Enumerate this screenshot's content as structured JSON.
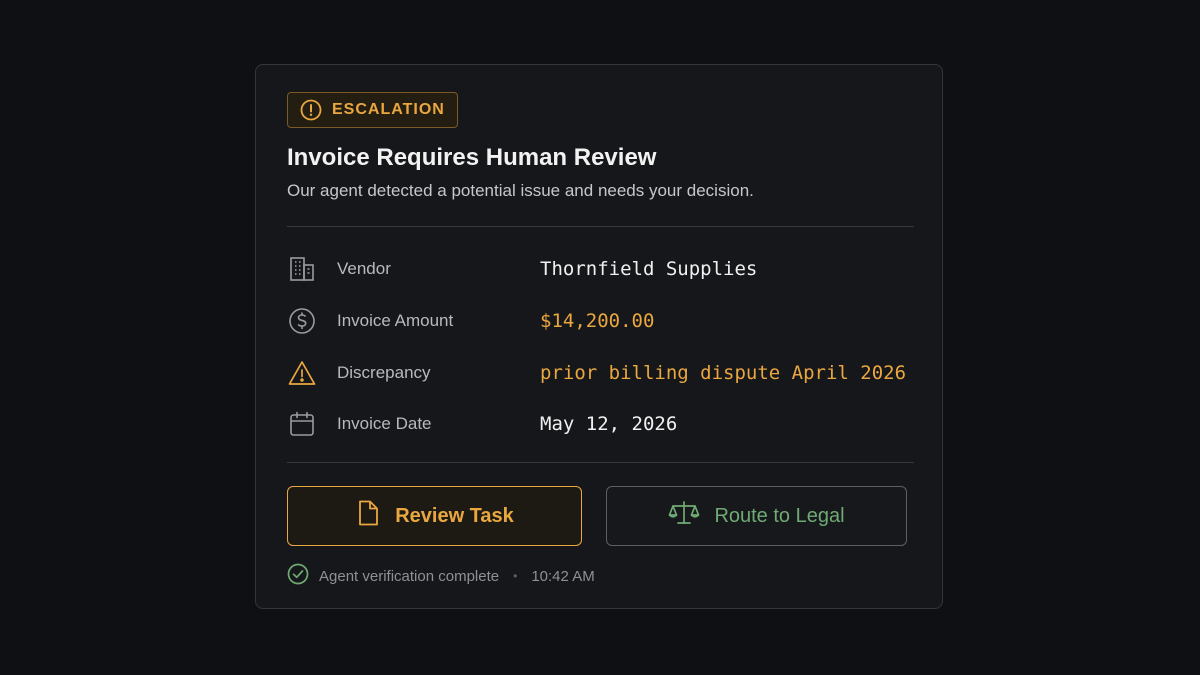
{
  "badge": {
    "label": "ESCALATION",
    "icon": "alert-circle-icon"
  },
  "header": {
    "title": "Invoice Requires Human Review",
    "subtitle": "Our agent detected a potential issue and needs your decision."
  },
  "details": [
    {
      "icon": "building-icon",
      "label": "Vendor",
      "value": "Thornfield Supplies",
      "accent": false
    },
    {
      "icon": "dollar-circle-icon",
      "label": "Invoice Amount",
      "value": "$14,200.00",
      "accent": true
    },
    {
      "icon": "warning-triangle-icon",
      "label": "Discrepancy",
      "value": "prior billing dispute April 2026",
      "accent": true
    },
    {
      "icon": "calendar-icon",
      "label": "Invoice Date",
      "value": "May 12, 2026",
      "accent": false
    }
  ],
  "actions": {
    "review_label": "Review Task",
    "review_icon": "document-icon",
    "legal_label": "Route to Legal",
    "legal_icon": "scales-icon"
  },
  "footer": {
    "status": "Agent verification complete",
    "status_icon": "check-circle-icon",
    "time": "10:42 AM"
  },
  "colors": {
    "accent": "#eaa73f",
    "legal_green": "#6faa74",
    "background": "#0f1013",
    "card": "#16171b"
  }
}
